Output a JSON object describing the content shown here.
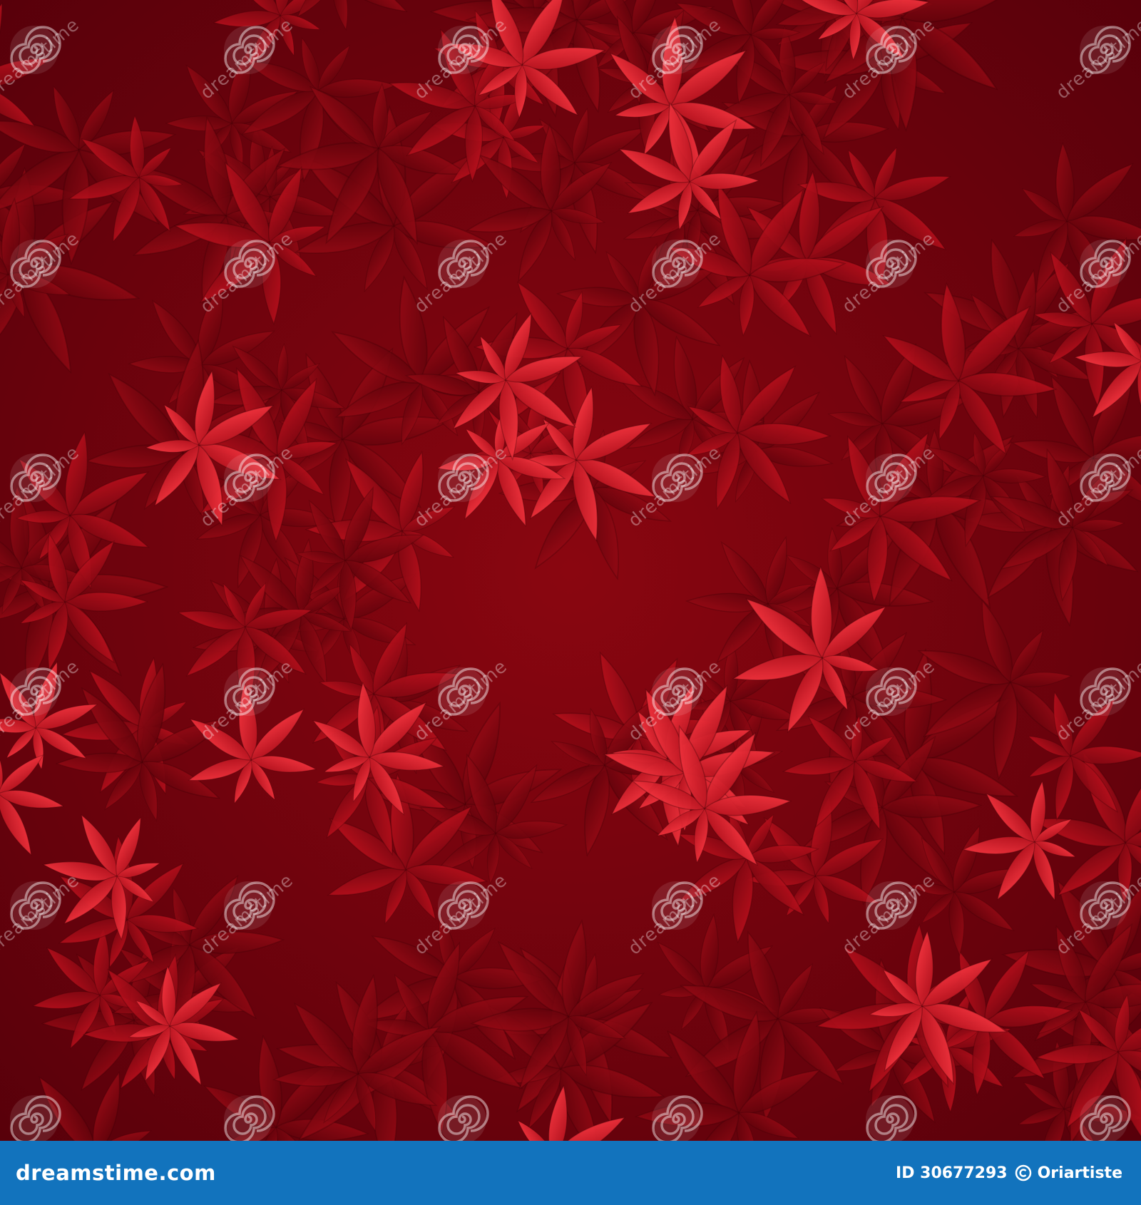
{
  "image": {
    "subject": "seamless red Japanese maple leaves pattern",
    "palette": {
      "background": "#5a0008",
      "leaf_dark": "#7c0510",
      "leaf_mid": "#a80f1a",
      "leaf_bright": "#e8202c",
      "footer": "#1273bd"
    }
  },
  "watermark": {
    "text": "dreamstime",
    "icon": "dreamstime-swirl-icon"
  },
  "footer": {
    "brand": "dreamstime.com",
    "id_text": "ID 30677293",
    "author": "Oriartiste",
    "author_icon": "copyright-icon"
  }
}
